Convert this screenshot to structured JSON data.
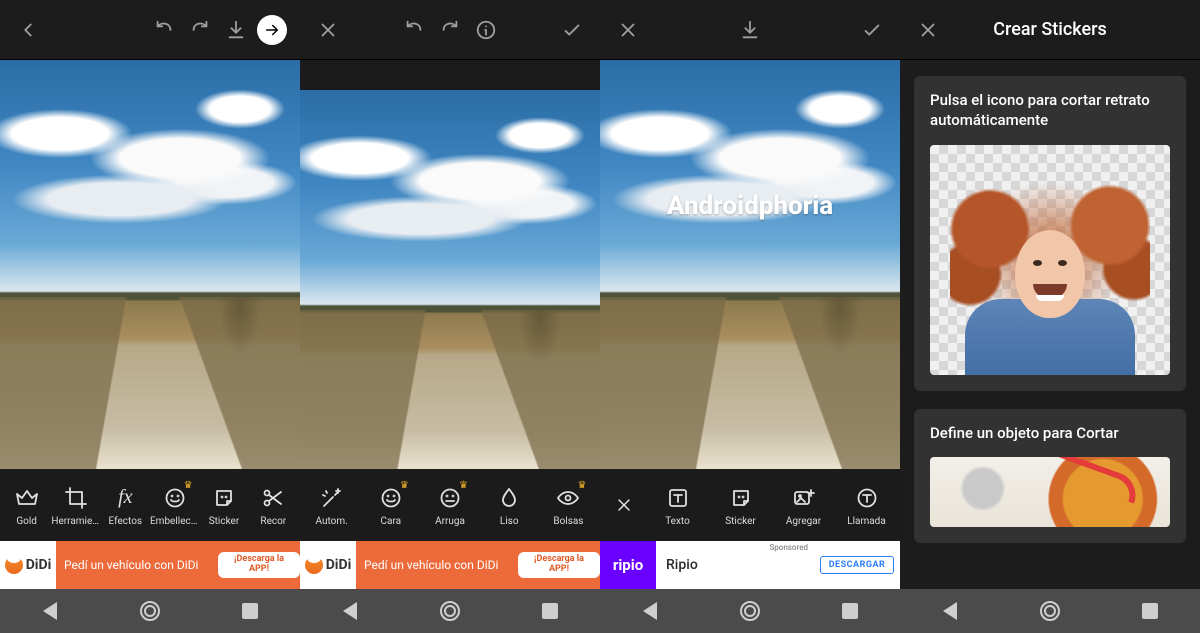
{
  "overlay": {
    "watermark": "Androidphoria"
  },
  "screen1": {
    "tools": [
      {
        "label": "Gold"
      },
      {
        "label": "Herramientas"
      },
      {
        "label": "Efectos"
      },
      {
        "label": "Embellecer"
      },
      {
        "label": "Sticker"
      },
      {
        "label": "Recor"
      }
    ],
    "ad": {
      "brand": "DiDi",
      "text": "Pedí un vehículo con DiDi",
      "cta": "¡Descarga la APP!"
    }
  },
  "screen2": {
    "tools": [
      {
        "label": "Autom."
      },
      {
        "label": "Cara"
      },
      {
        "label": "Arruga"
      },
      {
        "label": "Liso"
      },
      {
        "label": "Bolsas"
      }
    ],
    "ad": {
      "brand": "DiDi",
      "text": "Pedí un vehículo con DiDi",
      "cta": "¡Descarga la APP!"
    }
  },
  "screen3": {
    "tools": [
      {
        "label": "Texto"
      },
      {
        "label": "Sticker"
      },
      {
        "label": "Agregar"
      },
      {
        "label": "Llamada"
      }
    ],
    "ad": {
      "logo": "ripio",
      "brand": "Ripio",
      "sponsored": "Sponsored",
      "cta": "DESCARGAR"
    }
  },
  "screen4": {
    "title": "Crear Stickers",
    "card1": "Pulsa el icono para cortar retrato automáticamente",
    "card2": "Define un objeto para Cortar"
  }
}
